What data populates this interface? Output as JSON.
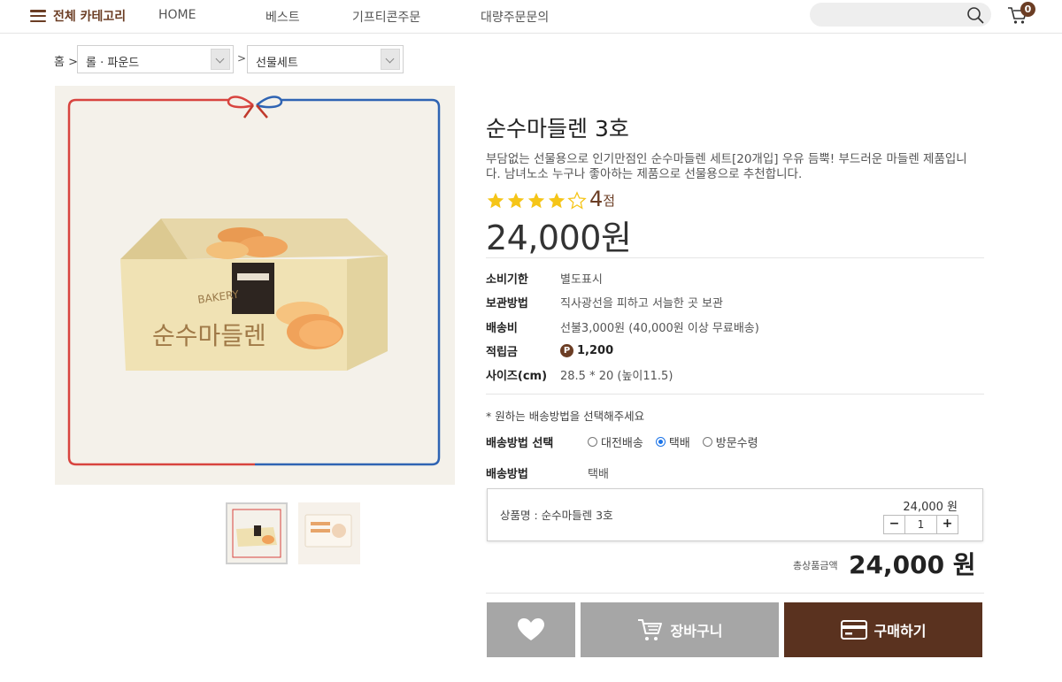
{
  "header": {
    "all_category": "전체 카테고리",
    "nav": [
      "HOME",
      "베스트",
      "기프티콘주문",
      "대량주문문의"
    ],
    "cart_count": "0",
    "search_placeholder": ""
  },
  "breadcrumb": {
    "home": "홈",
    "sep": ">",
    "level1": "롤 · 파운드",
    "level2": "선물세트"
  },
  "product": {
    "title": "순수마들렌 3호",
    "description": "부담없는 선물용으로 인기만점인 순수마들렌 세트[20개입] 우유 듬뿍! 부드러운 마들렌 제품입니다. 남녀노소 누구나 좋아하는 제품으로 선물용으로 추천합니다.",
    "rating": "4",
    "rating_unit": "점",
    "rating_value": 4,
    "rating_max": 5,
    "price": "24,000원",
    "box_text": "순수마들렌",
    "specs": [
      {
        "label": "소비기한",
        "value": "별도표시"
      },
      {
        "label": "보관방법",
        "value": "직사광선을 피하고 서늘한 곳 보관"
      },
      {
        "label": "배송비",
        "value": "선불3,000원 (40,000원 이상 무료배송)"
      },
      {
        "label": "적립금",
        "value": "1,200",
        "badge": "P"
      },
      {
        "label": "사이즈(cm)",
        "value": "28.5 * 20 (높이11.5)"
      }
    ]
  },
  "shipping": {
    "note": "* 원하는 배송방법을 선택해주세요",
    "select_label": "배송방법 선택",
    "options": [
      "대전배송",
      "택배",
      "방문수령"
    ],
    "selected": "택배",
    "method_label": "배송방법",
    "method_value": "택배"
  },
  "order": {
    "item_name": "상품명 : 순수마들렌 3호",
    "item_price": "24,000 원",
    "minus": "−",
    "qty": "1",
    "plus": "+",
    "total_label": "총상품금액",
    "total_value": "24,000 원"
  },
  "buttons": {
    "cart": "장바구니",
    "buy": "구매하기"
  },
  "colors": {
    "brand": "#5a321f",
    "accent": "#6b3d24",
    "button_gray": "#a6a6a6",
    "star": "#f5c518"
  }
}
